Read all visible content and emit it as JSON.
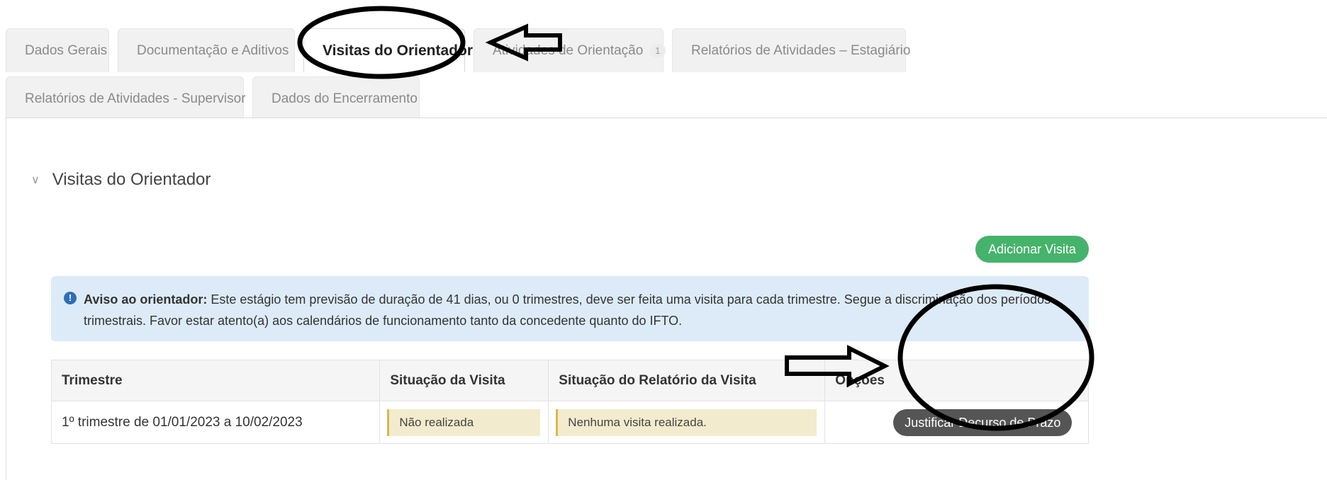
{
  "tabs_row1": [
    {
      "label": "Dados Gerais"
    },
    {
      "label": "Documentação e Aditivos"
    },
    {
      "label": "Visitas do Orientador"
    },
    {
      "label": "Atividades de Orientação",
      "badge": "1"
    },
    {
      "label": "Relatórios de Atividades – Estagiário"
    }
  ],
  "tabs_row2": [
    {
      "label": "Relatórios de Atividades - Supervisor"
    },
    {
      "label": "Dados do Encerramento"
    }
  ],
  "section": {
    "title": "Visitas do Orientador"
  },
  "actions": {
    "add_visit": "Adicionar Visita"
  },
  "alert": {
    "icon": "info-icon",
    "bold": "Aviso ao orientador:",
    "text": " Este estágio tem previsão de duração de 41 dias, ou 0 trimestres, deve ser feita uma visita para cada trimestre. Segue a discriminação dos períodos trimestrais. Favor estar atento(a) aos calendários de funcionamento tanto da concedente quanto do IFTO."
  },
  "table": {
    "headers": [
      "Trimestre",
      "Situação da Visita",
      "Situação do Relatório da Visita",
      "Opções"
    ],
    "rows": [
      {
        "trimestre": "1º trimestre de 01/01/2023 a 10/02/2023",
        "situacao_visita": "Não realizada",
        "situacao_relatorio": "Nenhuma visita realizada.",
        "opcao": "Justificar Decurso de Prazo"
      }
    ]
  }
}
